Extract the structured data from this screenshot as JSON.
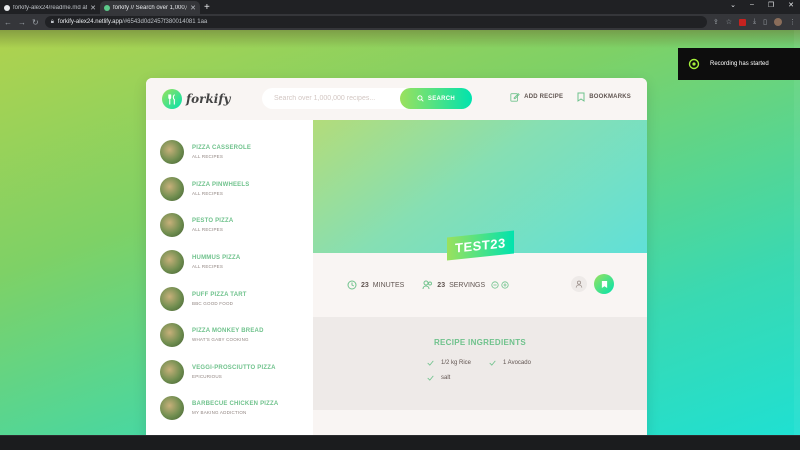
{
  "browser": {
    "tabs": [
      {
        "title": "forkify-alex24/readme.md at m"
      },
      {
        "title": "forkify // Search over 1,000,000"
      }
    ],
    "url": {
      "host": "forkify-alex24.netlify.app",
      "path": "/#6543d0d2457f380014081 1aa"
    }
  },
  "toast": {
    "text": "Recording has started"
  },
  "app": {
    "logo": "forkify",
    "search": {
      "placeholder": "Search over 1,000,000 recipes...",
      "button": "SEARCH"
    },
    "nav": {
      "add_recipe": "ADD RECIPE",
      "bookmarks": "BOOKMARKS"
    },
    "results": [
      {
        "title": "PIZZA CASSEROLE",
        "publisher": "ALL RECIPES"
      },
      {
        "title": "PIZZA PINWHEELS",
        "publisher": "ALL RECIPES"
      },
      {
        "title": "PESTO PIZZA",
        "publisher": "ALL RECIPES"
      },
      {
        "title": "HUMMUS PIZZA",
        "publisher": "ALL RECIPES"
      },
      {
        "title": "PUFF PIZZA TART",
        "publisher": "BBC GOOD FOOD"
      },
      {
        "title": "PIZZA MONKEY BREAD",
        "publisher": "WHAT'S GABY COOKING"
      },
      {
        "title": "VEGGI-PROSCIUTTO PIZZA",
        "publisher": "EPICURIOUS"
      },
      {
        "title": "BARBECUE CHICKEN PIZZA",
        "publisher": "MY BAKING ADDICTION"
      }
    ],
    "recipe": {
      "title": "TEST23",
      "minutes": {
        "value": "23",
        "unit": "MINUTES"
      },
      "servings": {
        "value": "23",
        "unit": "SERVINGS"
      },
      "ingredients_heading": "RECIPE INGREDIENTS",
      "ingredients": [
        "1/2 kg Rice",
        "1 Avocado",
        "salt"
      ]
    }
  }
}
